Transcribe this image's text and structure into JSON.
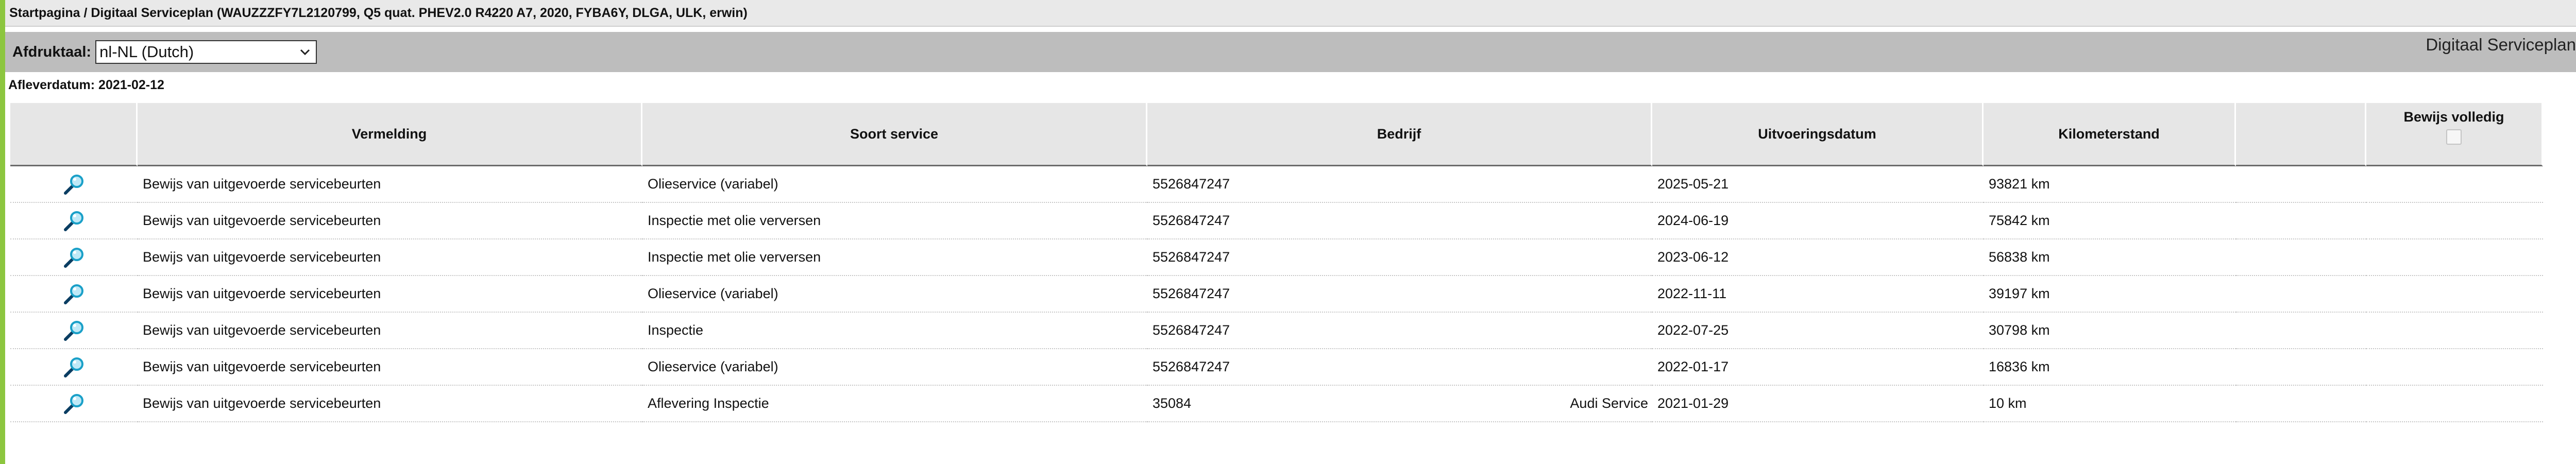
{
  "breadcrumb": "Startpagina / Digitaal Serviceplan (WAUZZZFY7L2120799, Q5 quat. PHEV2.0 R4220 A7, 2020, FYBA6Y, DLGA, ULK, erwin)",
  "toolbar": {
    "language_label": "Afdruktaal:",
    "language_value": "nl-NL (Dutch)",
    "page_heading": "Digitaal Serviceplan"
  },
  "delivery_date": "Afleverdatum: 2021-02-12",
  "table": {
    "headers": {
      "entry": "Vermelding",
      "service_type": "Soort service",
      "company": "Bedrijf",
      "execution_date": "Uitvoeringsdatum",
      "mileage": "Kilometerstand",
      "blank": "",
      "evidence_complete": "Bewijs volledig"
    },
    "rows": [
      {
        "entry": "Bewijs van uitgevoerde servicebeurten",
        "service_type": "Olieservice (variabel)",
        "company": "5526847247",
        "company_name": "",
        "date": "2025-05-21",
        "km": "93821 km"
      },
      {
        "entry": "Bewijs van uitgevoerde servicebeurten",
        "service_type": "Inspectie met olie verversen",
        "company": "5526847247",
        "company_name": "",
        "date": "2024-06-19",
        "km": "75842 km"
      },
      {
        "entry": "Bewijs van uitgevoerde servicebeurten",
        "service_type": "Inspectie met olie verversen",
        "company": "5526847247",
        "company_name": "",
        "date": "2023-06-12",
        "km": "56838 km"
      },
      {
        "entry": "Bewijs van uitgevoerde servicebeurten",
        "service_type": "Olieservice (variabel)",
        "company": "5526847247",
        "company_name": "",
        "date": "2022-11-11",
        "km": "39197 km"
      },
      {
        "entry": "Bewijs van uitgevoerde servicebeurten",
        "service_type": "Inspectie",
        "company": "5526847247",
        "company_name": "",
        "date": "2022-07-25",
        "km": "30798 km"
      },
      {
        "entry": "Bewijs van uitgevoerde servicebeurten",
        "service_type": "Olieservice (variabel)",
        "company": "5526847247",
        "company_name": "",
        "date": "2022-01-17",
        "km": "16836 km"
      },
      {
        "entry": "Bewijs van uitgevoerde servicebeurten",
        "service_type": "Aflevering Inspectie",
        "company": "35084",
        "company_name": "Audi Service",
        "date": "2021-01-29",
        "km": "10 km"
      }
    ]
  },
  "icons": {
    "row_action": "magnifier-icon",
    "select_caret": "chevron-down-icon"
  },
  "colors": {
    "accent_left_rule": "#8cc63f",
    "toolbar_bg": "#bdbdbd",
    "header_bg": "#e6e6e6",
    "magnifier_lens": "#1aa0c8"
  }
}
